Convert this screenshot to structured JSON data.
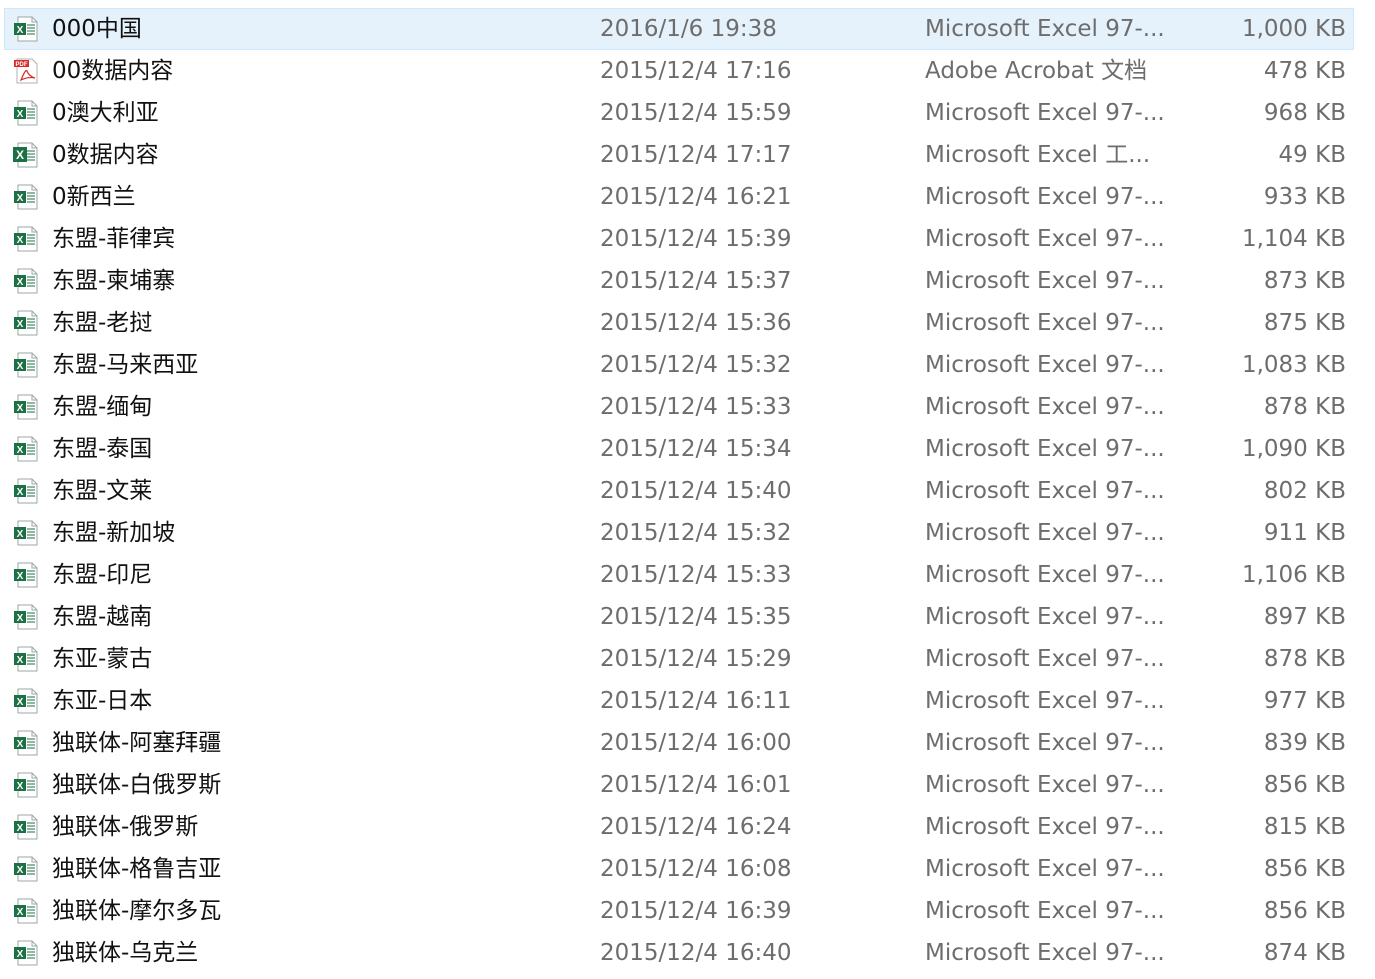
{
  "colors": {
    "selection_bg": "#e5f1fb",
    "selection_border": "#cce8ff",
    "excel_green": "#1d7044",
    "pdf_red": "#d92b2b",
    "secondary_text": "#6d6d6d"
  },
  "icon_labels": {
    "excel_xls": "X",
    "excel_xlsx": "X",
    "pdf": "PDF"
  },
  "files": [
    {
      "name": "000中国",
      "date": "2016/1/6 19:38",
      "type": "Microsoft Excel 97-...",
      "size": "1,000 KB",
      "icon": "excel-xls-icon",
      "selected": true
    },
    {
      "name": "00数据内容",
      "date": "2015/12/4 17:16",
      "type": "Adobe Acrobat 文档",
      "size": "478 KB",
      "icon": "pdf-icon",
      "selected": false
    },
    {
      "name": "0澳大利亚",
      "date": "2015/12/4 15:59",
      "type": "Microsoft Excel 97-...",
      "size": "968 KB",
      "icon": "excel-xls-icon",
      "selected": false
    },
    {
      "name": "0数据内容",
      "date": "2015/12/4 17:17",
      "type": "Microsoft Excel 工...",
      "size": "49 KB",
      "icon": "excel-xlsx-icon",
      "selected": false
    },
    {
      "name": "0新西兰",
      "date": "2015/12/4 16:21",
      "type": "Microsoft Excel 97-...",
      "size": "933 KB",
      "icon": "excel-xls-icon",
      "selected": false
    },
    {
      "name": "东盟-菲律宾",
      "date": "2015/12/4 15:39",
      "type": "Microsoft Excel 97-...",
      "size": "1,104 KB",
      "icon": "excel-xls-icon",
      "selected": false
    },
    {
      "name": "东盟-柬埔寨",
      "date": "2015/12/4 15:37",
      "type": "Microsoft Excel 97-...",
      "size": "873 KB",
      "icon": "excel-xls-icon",
      "selected": false
    },
    {
      "name": "东盟-老挝",
      "date": "2015/12/4 15:36",
      "type": "Microsoft Excel 97-...",
      "size": "875 KB",
      "icon": "excel-xls-icon",
      "selected": false
    },
    {
      "name": "东盟-马来西亚",
      "date": "2015/12/4 15:32",
      "type": "Microsoft Excel 97-...",
      "size": "1,083 KB",
      "icon": "excel-xls-icon",
      "selected": false
    },
    {
      "name": "东盟-缅甸",
      "date": "2015/12/4 15:33",
      "type": "Microsoft Excel 97-...",
      "size": "878 KB",
      "icon": "excel-xls-icon",
      "selected": false
    },
    {
      "name": "东盟-泰国",
      "date": "2015/12/4 15:34",
      "type": "Microsoft Excel 97-...",
      "size": "1,090 KB",
      "icon": "excel-xls-icon",
      "selected": false
    },
    {
      "name": "东盟-文莱",
      "date": "2015/12/4 15:40",
      "type": "Microsoft Excel 97-...",
      "size": "802 KB",
      "icon": "excel-xls-icon",
      "selected": false
    },
    {
      "name": "东盟-新加坡",
      "date": "2015/12/4 15:32",
      "type": "Microsoft Excel 97-...",
      "size": "911 KB",
      "icon": "excel-xls-icon",
      "selected": false
    },
    {
      "name": "东盟-印尼",
      "date": "2015/12/4 15:33",
      "type": "Microsoft Excel 97-...",
      "size": "1,106 KB",
      "icon": "excel-xls-icon",
      "selected": false
    },
    {
      "name": "东盟-越南",
      "date": "2015/12/4 15:35",
      "type": "Microsoft Excel 97-...",
      "size": "897 KB",
      "icon": "excel-xls-icon",
      "selected": false
    },
    {
      "name": "东亚-蒙古",
      "date": "2015/12/4 15:29",
      "type": "Microsoft Excel 97-...",
      "size": "878 KB",
      "icon": "excel-xls-icon",
      "selected": false
    },
    {
      "name": "东亚-日本",
      "date": "2015/12/4 16:11",
      "type": "Microsoft Excel 97-...",
      "size": "977 KB",
      "icon": "excel-xls-icon",
      "selected": false
    },
    {
      "name": "独联体-阿塞拜疆",
      "date": "2015/12/4 16:00",
      "type": "Microsoft Excel 97-...",
      "size": "839 KB",
      "icon": "excel-xls-icon",
      "selected": false
    },
    {
      "name": "独联体-白俄罗斯",
      "date": "2015/12/4 16:01",
      "type": "Microsoft Excel 97-...",
      "size": "856 KB",
      "icon": "excel-xls-icon",
      "selected": false
    },
    {
      "name": "独联体-俄罗斯",
      "date": "2015/12/4 16:24",
      "type": "Microsoft Excel 97-...",
      "size": "815 KB",
      "icon": "excel-xls-icon",
      "selected": false
    },
    {
      "name": "独联体-格鲁吉亚",
      "date": "2015/12/4 16:08",
      "type": "Microsoft Excel 97-...",
      "size": "856 KB",
      "icon": "excel-xls-icon",
      "selected": false
    },
    {
      "name": "独联体-摩尔多瓦",
      "date": "2015/12/4 16:39",
      "type": "Microsoft Excel 97-...",
      "size": "856 KB",
      "icon": "excel-xls-icon",
      "selected": false
    },
    {
      "name": "独联体-乌克兰",
      "date": "2015/12/4 16:40",
      "type": "Microsoft Excel 97-...",
      "size": "874 KB",
      "icon": "excel-xls-icon",
      "selected": false
    }
  ]
}
